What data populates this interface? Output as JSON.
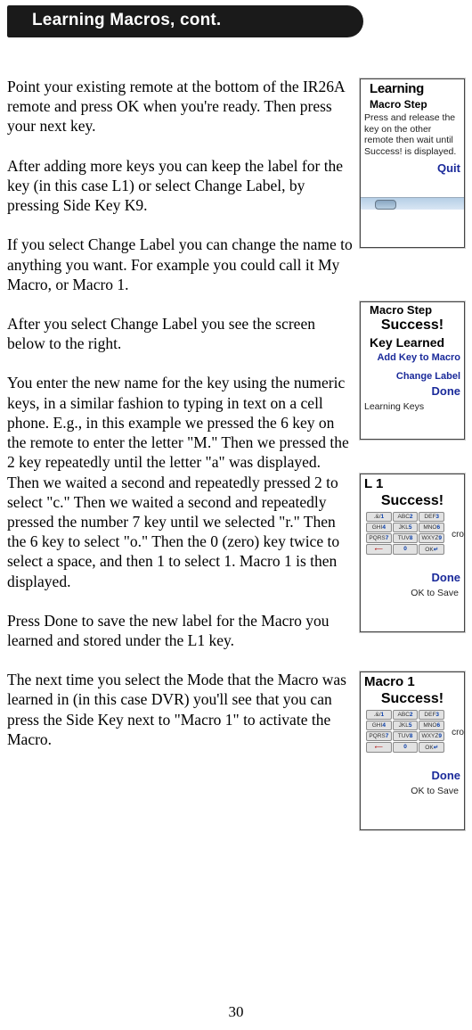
{
  "header_title": "Learning Macros, cont.",
  "paragraphs": {
    "p1": "Point your existing remote at the bottom of the IR26A remote and press OK when you're ready. Then press your next key.",
    "p2": "After adding more keys you can keep the label for the key (in this case L1) or select Change Label, by pressing Side Key K9.",
    "p3": "If you select Change Label you can change the name to anything you want. For example you could call it My Macro, or Macro 1.",
    "p4": "After you select Change Label you see the screen below to the right.",
    "p5": "You enter the new name for the key using the numeric keys, in a similar fashion to typing in text on a cell phone. E.g., in this example we pressed the 6 key on the remote to enter the letter \"M.\" Then we pressed the 2 key repeatedly until the letter \"a\" was displayed. Then we waited a second and repeatedly pressed 2 to select \"c.\" Then we waited a second and repeatedly pressed the number 7 key until we selected \"r.\" Then the 6 key to select \"o.\" Then the 0 (zero) key twice to select a space, and then 1 to select 1. Macro 1 is then displayed.",
    "p6": "Press Done to save the new label for the Macro you learned and stored under the L1 key.",
    "p7": "The next time you select the Mode that the Macro was learned in (in this case DVR) you'll see that you can press the Side Key next to \"Macro 1\" to activate the Macro."
  },
  "screenshots": {
    "s1": {
      "title": "Learning",
      "subtitle": "Macro Step",
      "text": "Press and release the key on the other remote then wait until Success! is displayed.",
      "quit": "Quit"
    },
    "s2": {
      "title": "Macro Step",
      "success": "Success!",
      "learned": "Key Learned",
      "add": "Add Key to Macro",
      "change": "Change Label",
      "done": "Done",
      "learning": "Learning Keys"
    },
    "s3": {
      "title": "L 1",
      "success": "Success!",
      "cro": "cro",
      "done": "Done",
      "ok": "OK to Save"
    },
    "s4": {
      "title": "Macro 1",
      "success": "Success!",
      "cro": "cro",
      "done": "Done",
      "ok": "OK to Save"
    }
  },
  "page_number": "30"
}
